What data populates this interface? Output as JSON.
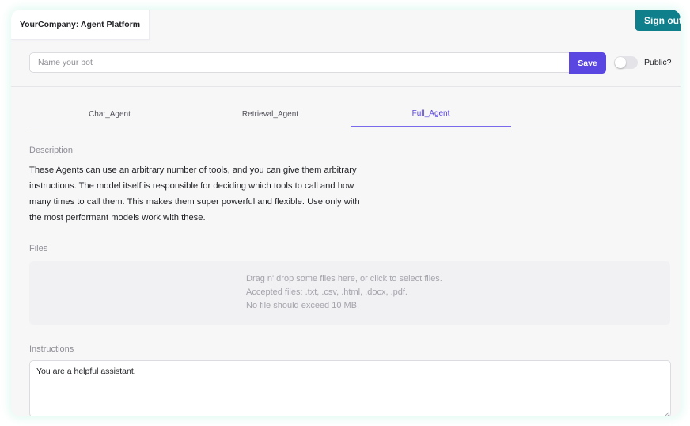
{
  "app": {
    "title": "YourCompany: Agent Platform",
    "sign_out_label": "Sign out"
  },
  "bot_form": {
    "name_placeholder": "Name your bot",
    "name_value": "",
    "save_label": "Save",
    "public_label": "Public?",
    "public_enabled": false
  },
  "tabs": [
    {
      "label": "Chat_Agent",
      "active": false
    },
    {
      "label": "Retrieval_Agent",
      "active": false
    },
    {
      "label": "Full_Agent",
      "active": true
    }
  ],
  "description": {
    "heading": "Description",
    "lines": [
      "These Agents can use an arbitrary number of tools, and you can give them arbitrary",
      "instructions. The model itself is responsible for deciding which tools to call and how",
      "many times to call them. This makes them super powerful and flexible. Use only with",
      "the most performant models work with these."
    ]
  },
  "files": {
    "heading": "Files",
    "dropzone_lines": [
      "Drag n' drop some files here, or click to select files.",
      "Accepted files: .txt, .csv, .html, .docx, .pdf.",
      "No file should exceed 10 MB."
    ]
  },
  "instructions": {
    "heading": "Instructions",
    "value": "You are a helpful assistant."
  },
  "colors": {
    "accent": "#5a46e0",
    "sign_out": "#0f7f8c",
    "background": "#f7f7f8"
  }
}
